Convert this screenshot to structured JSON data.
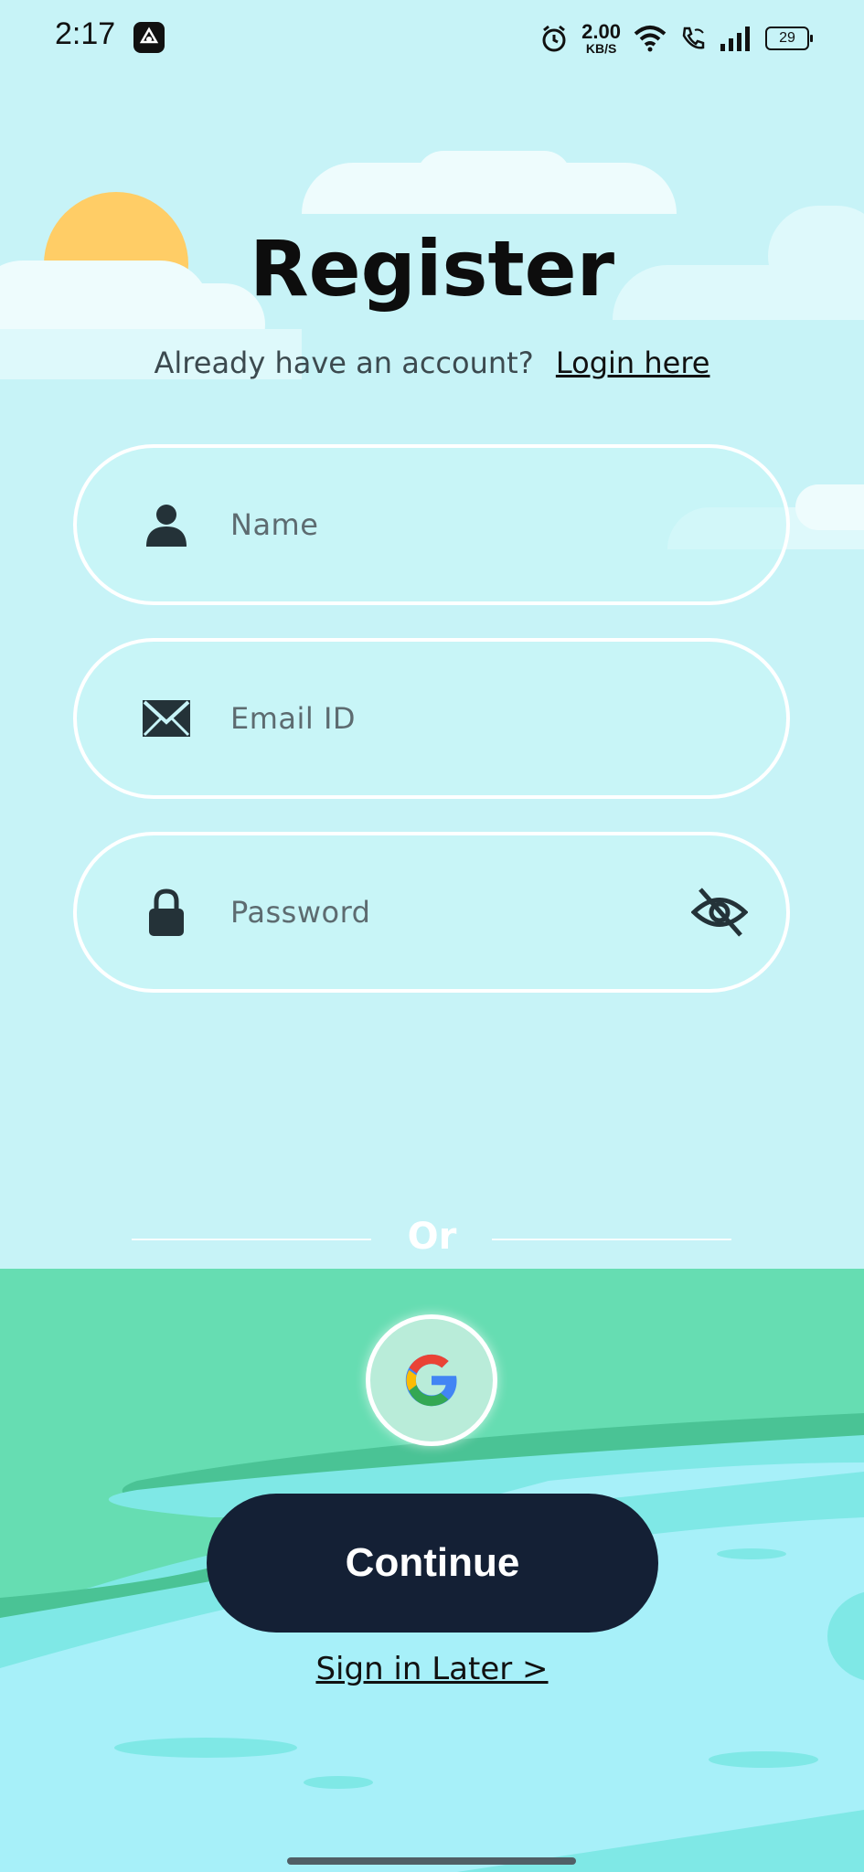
{
  "status_bar": {
    "time": "2:17",
    "net_speed_value": "2.00",
    "net_speed_unit": "KB/S",
    "battery": "29",
    "icons": [
      "app-notification-icon",
      "alarm-icon",
      "wifi-icon",
      "wifi-call-icon",
      "signal-icon",
      "battery-icon"
    ]
  },
  "header": {
    "title": "Register",
    "subtitle": "Already have an account?",
    "login_link": "Login here"
  },
  "form": {
    "name_placeholder": "Name",
    "email_placeholder": "Email ID",
    "password_placeholder": "Password"
  },
  "divider": {
    "text": "Or"
  },
  "actions": {
    "continue_label": "Continue",
    "sign_in_later": "Sign in Later >"
  },
  "colors": {
    "sky": "#c7f3f7",
    "sun": "#ffcd66",
    "grass": "#66ddb2",
    "water": "#a7f0f9",
    "button": "#142035"
  }
}
